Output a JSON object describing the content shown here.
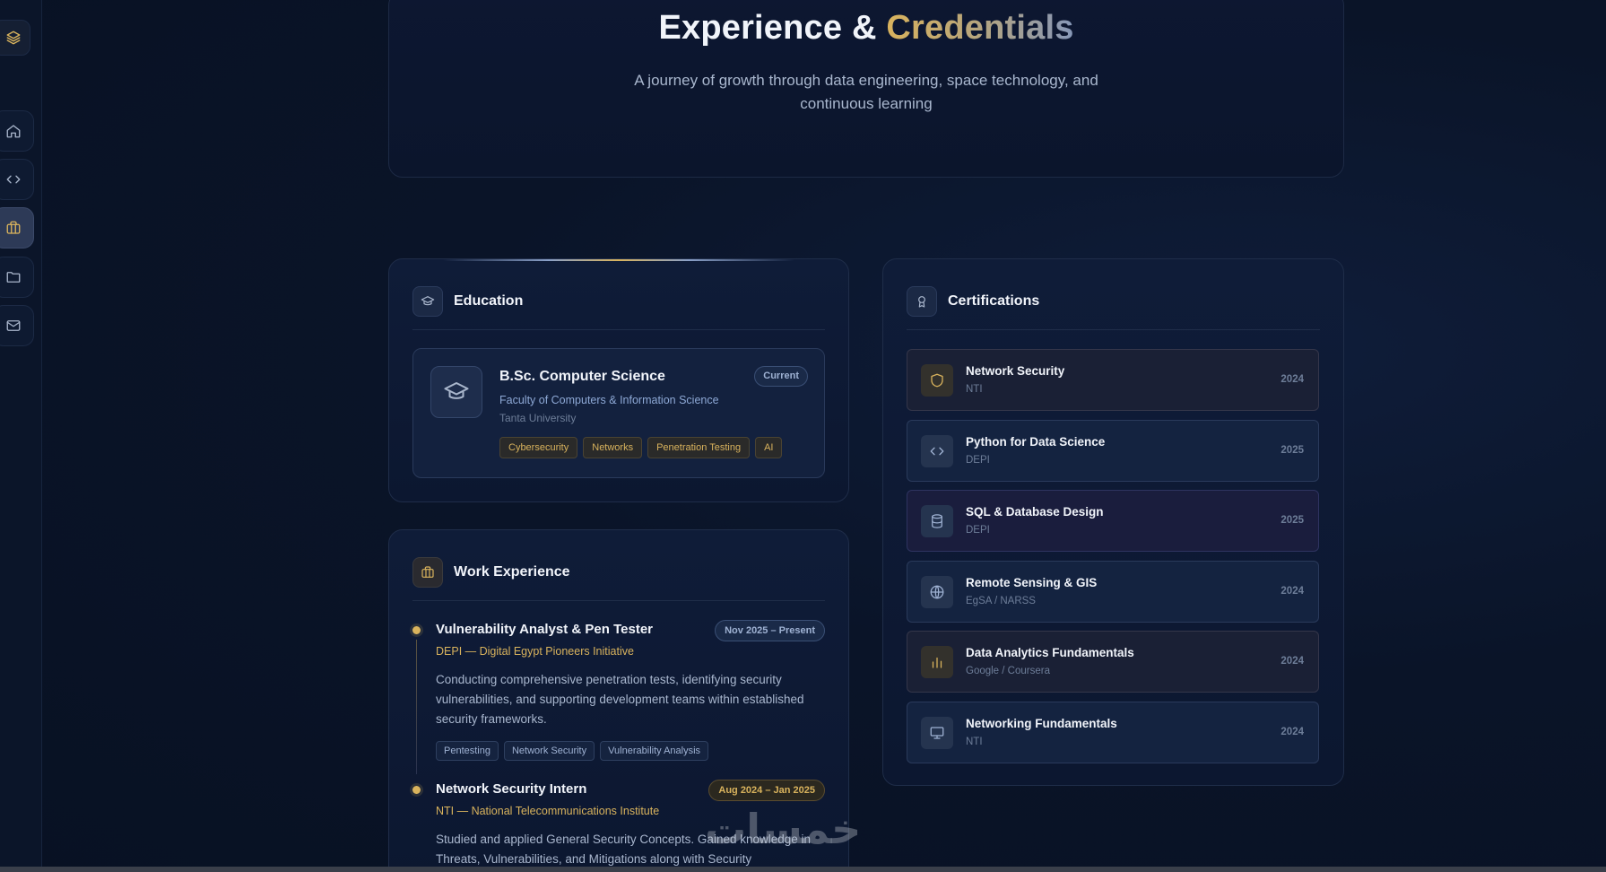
{
  "header": {
    "title_main": "Experience & ",
    "title_accent": "Credentials",
    "subtitle": "A journey of growth through data engineering, space technology, and continuous learning"
  },
  "sidebar": {
    "items": [
      {
        "name": "logo",
        "icon": "layers-icon"
      },
      {
        "name": "home",
        "icon": "home-icon"
      },
      {
        "name": "code",
        "icon": "code-icon"
      },
      {
        "name": "experience",
        "icon": "briefcase-icon",
        "active": true
      },
      {
        "name": "projects",
        "icon": "folder-icon"
      },
      {
        "name": "contact",
        "icon": "mail-icon"
      }
    ]
  },
  "education": {
    "title": "Education",
    "degree": "B.Sc. Computer Science",
    "faculty": "Faculty of Computers & Information Science",
    "university": "Tanta University",
    "status": "Current",
    "tags": [
      "Cybersecurity",
      "Networks",
      "Penetration Testing",
      "AI"
    ]
  },
  "work": {
    "title": "Work Experience",
    "jobs": [
      {
        "title": "Vulnerability Analyst & Pen Tester",
        "org": "DEPI — Digital Egypt Pioneers Initiative",
        "date": "Nov 2025 – Present",
        "description": "Conducting comprehensive penetration tests, identifying security vulnerabilities, and supporting development teams within established security frameworks.",
        "tags": [
          "Pentesting",
          "Network Security",
          "Vulnerability Analysis"
        ]
      },
      {
        "title": "Network Security Intern",
        "org": "NTI — National Telecommunications Institute",
        "date": "Aug 2024 – Jan 2025",
        "description": "Studied and applied General Security Concepts. Gained knowledge in Threats, Vulnerabilities, and Mitigations along with Security"
      }
    ]
  },
  "certifications": {
    "title": "Certifications",
    "items": [
      {
        "name": "Network Security",
        "issuer": "NTI",
        "year": "2024",
        "icon": "shield-icon"
      },
      {
        "name": "Python for Data Science",
        "issuer": "DEPI",
        "year": "2025",
        "icon": "code-icon"
      },
      {
        "name": "SQL & Database Design",
        "issuer": "DEPI",
        "year": "2025",
        "icon": "database-icon"
      },
      {
        "name": "Remote Sensing & GIS",
        "issuer": "EgSA / NARSS",
        "year": "2024",
        "icon": "globe-icon"
      },
      {
        "name": "Data Analytics Fundamentals",
        "issuer": "Google / Coursera",
        "year": "2024",
        "icon": "bar-chart-icon"
      },
      {
        "name": "Networking Fundamentals",
        "issuer": "NTI",
        "year": "2024",
        "icon": "monitor-icon"
      }
    ]
  },
  "watermark": "خمسات",
  "colors": {
    "accent_gold": "#d9b35d",
    "background": "#0a1428",
    "card": "#0f1c38"
  }
}
